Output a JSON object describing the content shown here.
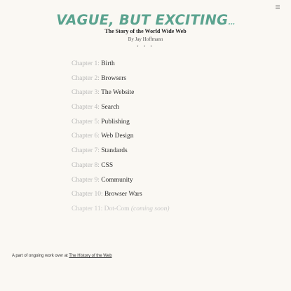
{
  "header": {
    "menu_icon": "hamburger-menu-icon",
    "title": "VAGUE, BUT EXCITING",
    "title_trailing": "...",
    "title_color": "#5ba38f",
    "subtitle": "The Story of the World Wide Web",
    "byline": "By Jay Hoffmann",
    "ornament": "• • •"
  },
  "chapters": [
    {
      "num": "Chapter 1:",
      "name": "Birth"
    },
    {
      "num": "Chapter 2:",
      "name": "Browsers"
    },
    {
      "num": "Chapter 3:",
      "name": "The Website"
    },
    {
      "num": "Chapter 4:",
      "name": "Search"
    },
    {
      "num": "Chapter 5:",
      "name": "Publishing"
    },
    {
      "num": "Chapter 6:",
      "name": "Web Design"
    },
    {
      "num": "Chapter 7:",
      "name": "Standards"
    },
    {
      "num": "Chapter 8:",
      "name": "CSS"
    },
    {
      "num": "Chapter 9:",
      "name": "Community"
    },
    {
      "num": "Chapter 10:",
      "name": "Browser Wars"
    },
    {
      "num": "Chapter 11:",
      "name": "Dot-Com",
      "note": "(coming soon)"
    }
  ],
  "footer": {
    "text": "A part of ongoing work over at ",
    "link": "The History of the Web"
  }
}
